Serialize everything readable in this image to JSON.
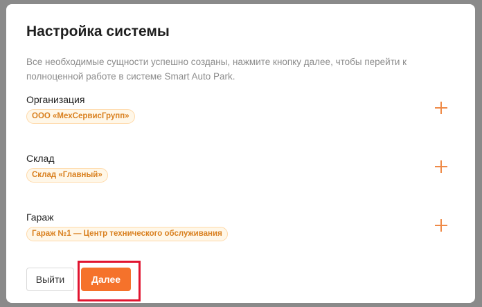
{
  "dialog": {
    "title": "Настройка системы",
    "description": "Все необходимые сущности успешно созданы, нажмите кнопку далее, чтобы перейти к полноценной работе в системе Smart Auto Park."
  },
  "sections": [
    {
      "label": "Организация",
      "tag": "ООО «МехСервисГрупп»",
      "add_icon": "plus-icon"
    },
    {
      "label": "Склад",
      "tag": "Склад «Главный»",
      "add_icon": "plus-icon"
    },
    {
      "label": "Гараж",
      "tag": "Гараж №1 — Центр технического обслуживания",
      "add_icon": "plus-icon"
    }
  ],
  "footer": {
    "exit_label": "Выйти",
    "next_label": "Далее"
  },
  "colors": {
    "accent": "#f5722b",
    "tag_text": "#d9801f",
    "tag_bg": "#fff7e8",
    "highlight": "#e1142f"
  }
}
